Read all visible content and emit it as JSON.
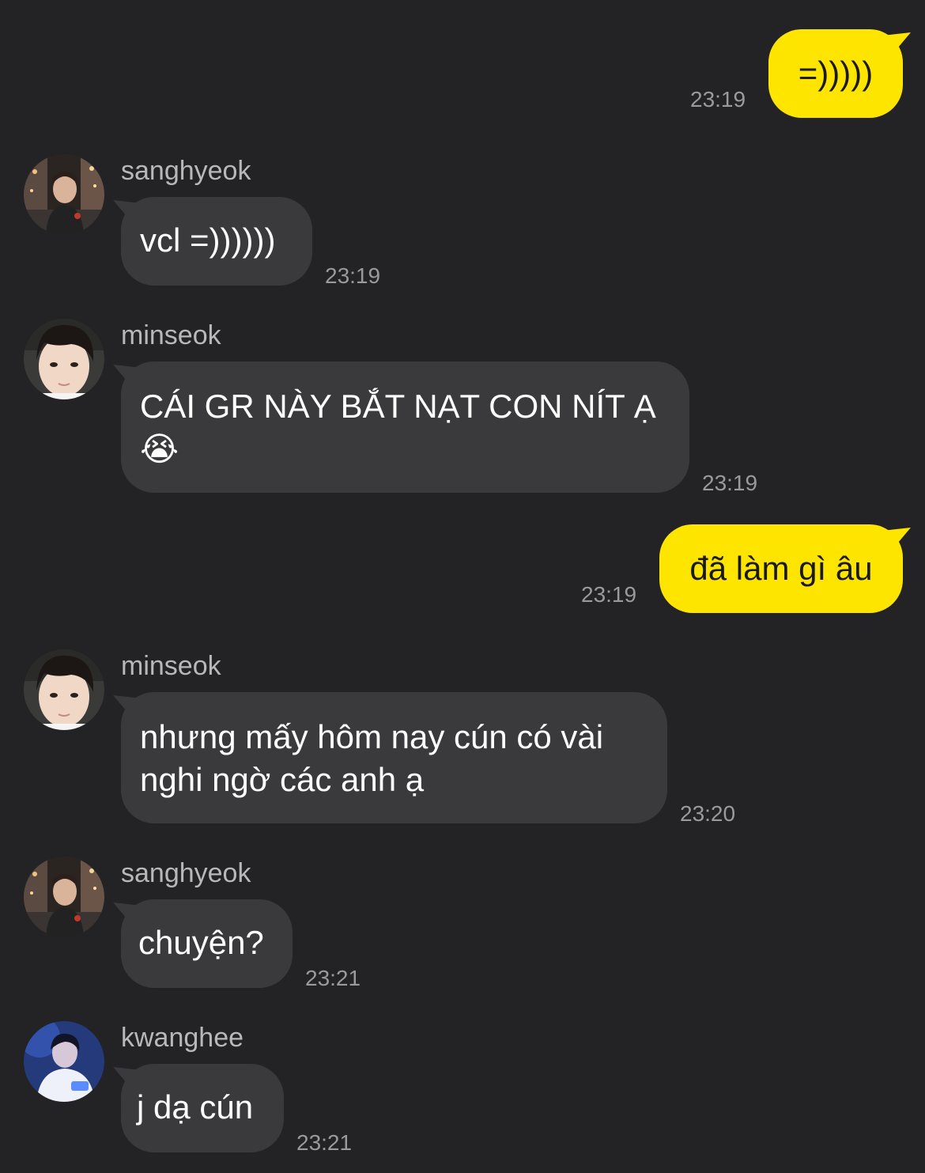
{
  "theme": {
    "background": "#232325",
    "outgoing_bubble": "#fee500",
    "incoming_bubble": "#3a3a3c",
    "timestamp_color": "#9a9a9e"
  },
  "messages": [
    {
      "side": "outgoing",
      "text": "=)))))",
      "time": "23:19"
    },
    {
      "side": "incoming",
      "sender": "sanghyeok",
      "avatar": "avatar-photo-city-night",
      "text": "vcl =))))))",
      "time": "23:19"
    },
    {
      "side": "incoming",
      "sender": "minseok",
      "avatar": "avatar-photo-selfie",
      "text_line1": "CÁI GR NÀY BẮT NẠT CON NÍT Ạ",
      "text_line2": "😭",
      "time": "23:19"
    },
    {
      "side": "outgoing",
      "text": "đã làm gì âu",
      "time": "23:19"
    },
    {
      "side": "incoming",
      "sender": "minseok",
      "avatar": "avatar-photo-selfie",
      "text_line1": "nhưng mấy hôm nay cún có vài",
      "text_line2": "nghi ngờ các anh ạ",
      "time": "23:20"
    },
    {
      "side": "incoming",
      "sender": "sanghyeok",
      "avatar": "avatar-photo-city-night",
      "text": "chuyện?",
      "time": "23:21"
    },
    {
      "side": "incoming",
      "sender": "kwanghee",
      "avatar": "avatar-photo-blue-light",
      "text": "j dạ cún",
      "time": "23:21"
    }
  ]
}
